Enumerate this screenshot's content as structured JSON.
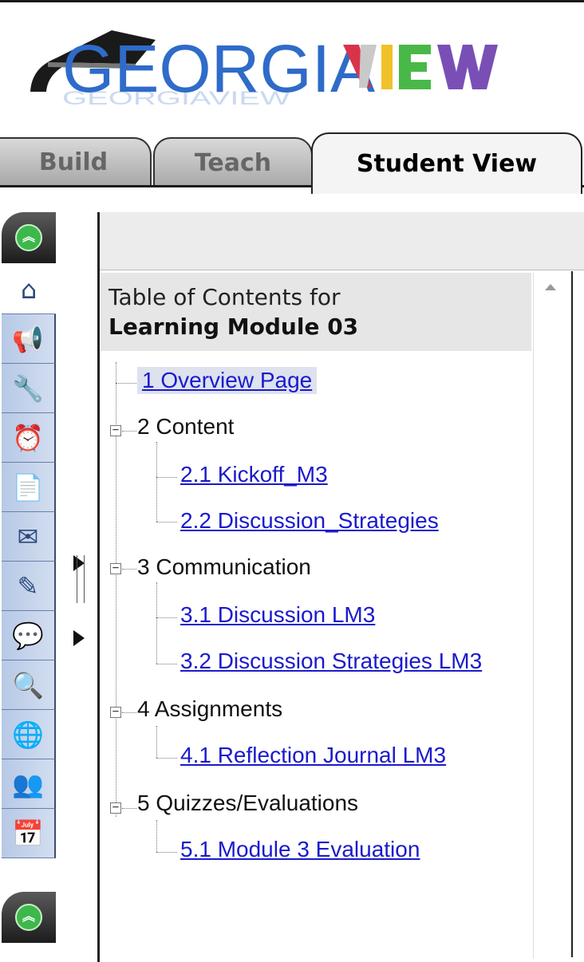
{
  "logo": {
    "text_left": "GEORGIA",
    "text_right": "VIEW",
    "colors": {
      "blue": "#2f6bc9",
      "grey": "#c9c9c9",
      "red": "#d9334a",
      "yellow": "#f0c12a",
      "green": "#49b848",
      "purple": "#7a4fb5"
    }
  },
  "tabs": [
    {
      "label": "Build"
    },
    {
      "label": "Teach"
    },
    {
      "label": "Student View"
    }
  ],
  "rail": {
    "items": [
      {
        "name": "home",
        "icon": "home-icon",
        "glyph": "⌂"
      },
      {
        "name": "announcements",
        "icon": "megaphone-icon",
        "glyph": "📢"
      },
      {
        "name": "tools-new",
        "icon": "tools-icon",
        "glyph": "🔧"
      },
      {
        "name": "schedule",
        "icon": "clock-icon",
        "glyph": "⏰"
      },
      {
        "name": "assignments",
        "icon": "document-icon",
        "glyph": "📄"
      },
      {
        "name": "mail",
        "icon": "envelope-icon",
        "glyph": "✉"
      },
      {
        "name": "tasks",
        "icon": "wand-icon",
        "glyph": "✎"
      },
      {
        "name": "discussions",
        "icon": "chat-icon",
        "glyph": "💬"
      },
      {
        "name": "search",
        "icon": "search-icon",
        "glyph": "🔍"
      },
      {
        "name": "web-links",
        "icon": "globe-icon",
        "glyph": "🌐"
      },
      {
        "name": "roster",
        "icon": "people-icon",
        "glyph": "👥"
      },
      {
        "name": "calendar",
        "icon": "calendar-icon",
        "glyph": "📅"
      }
    ]
  },
  "toc": {
    "heading_line1": "Table of Contents for",
    "heading_line2": "Learning Module 03",
    "items": [
      {
        "label": "1 Overview Page",
        "type": "link",
        "selected": true
      },
      {
        "label": "2 Content",
        "type": "folder"
      },
      {
        "label": "2.1 Kickoff_M3",
        "type": "link"
      },
      {
        "label": "2.2 Discussion_Strategies",
        "type": "link"
      },
      {
        "label": "3 Communication",
        "type": "folder"
      },
      {
        "label": "3.1 Discussion LM3",
        "type": "link"
      },
      {
        "label": "3.2 Discussion Strategies LM3",
        "type": "link"
      },
      {
        "label": "4 Assignments",
        "type": "folder"
      },
      {
        "label": "4.1 Reflection Journal LM3",
        "type": "link"
      },
      {
        "label": "5 Quizzes/Evaluations",
        "type": "folder"
      },
      {
        "label": "5.1 Module 3 Evaluation",
        "type": "link"
      }
    ]
  }
}
